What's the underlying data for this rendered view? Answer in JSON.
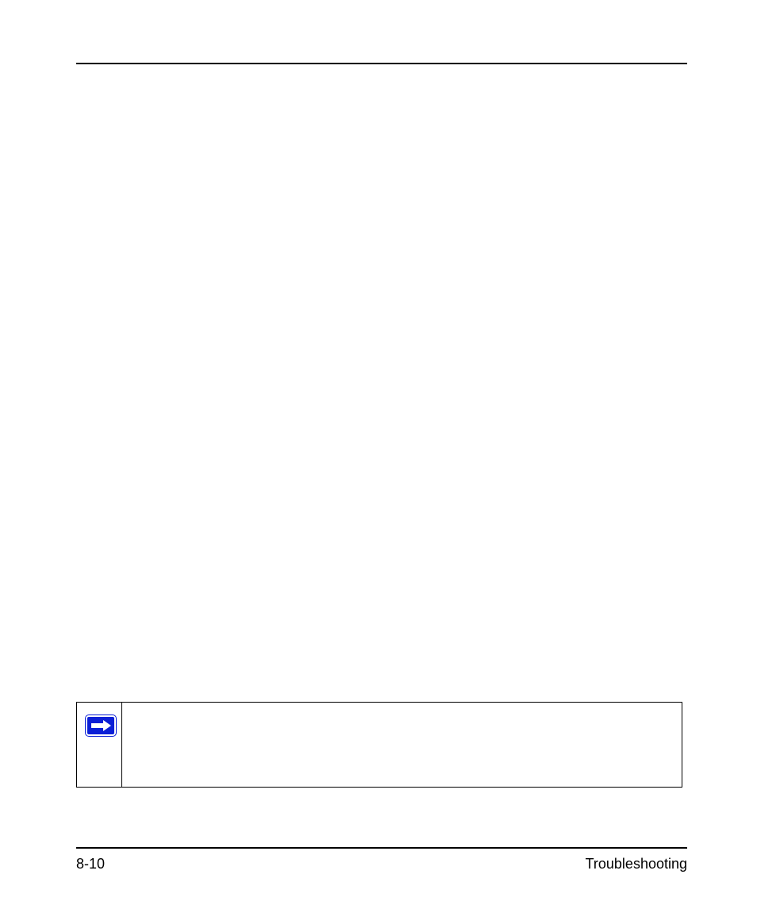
{
  "footer": {
    "page_number": "8-10",
    "section_title": "Troubleshooting"
  },
  "note": {
    "icon_name": "arrow-right-icon"
  }
}
